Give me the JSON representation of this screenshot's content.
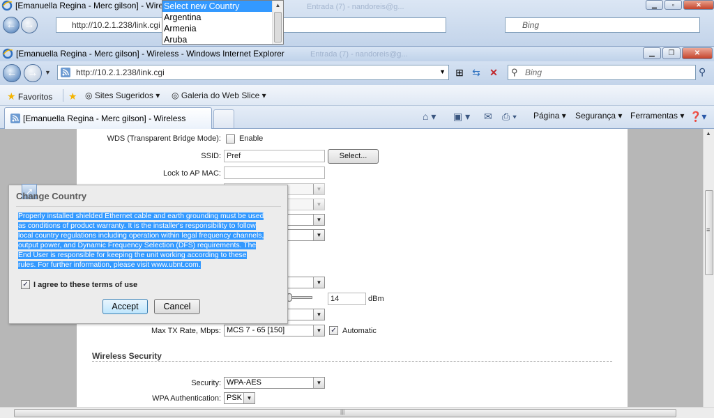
{
  "ghost_window": {
    "title": "[Emanuella Regina - Merc gilson] - Wire",
    "ghost_tab": "Entrada (7) - nandoreis@g...",
    "url": "http://10.2.1.238/link.cgi",
    "search_placeholder": "Bing",
    "fav_text": "Favoritos  Sites Sugeridos"
  },
  "country_dropdown": {
    "options": [
      "Select new Country",
      "Argentina",
      "Armenia",
      "Aruba"
    ],
    "selected_index": 0
  },
  "window": {
    "title": "[Emanuella Regina - Merc gilson] - Wireless - Windows Internet Explorer",
    "ghost_tab": "Entrada (7) - nandoreis@g..."
  },
  "navbar": {
    "url": "http://10.2.1.238/link.cgi",
    "search_placeholder": "Bing"
  },
  "favorites_bar": {
    "favorites": "Favoritos",
    "suggested_sites": "Sites Sugeridos",
    "web_slice_gallery": "Galeria do Web Slice"
  },
  "tabbar": {
    "active_tab": "[Emanuella Regina - Merc gilson] - Wireless",
    "commands": {
      "page": "Página",
      "security": "Segurança",
      "tools": "Ferramentas"
    }
  },
  "form": {
    "wds_label": "WDS (Transparent Bridge Mode):",
    "wds_enable": "Enable",
    "ssid_label": "SSID:",
    "ssid_value": "Pref",
    "select_button": "Select...",
    "lock_ap_label": "Lock to AP MAC:",
    "tx_power_value": "14",
    "tx_power_unit": "dBm",
    "max_tx_rate_label": "Max TX Rate, Mbps:",
    "max_tx_rate_value": "MCS 7 - 65 [150]",
    "automatic_label": "Automatic",
    "wireless_security_heading": "Wireless Security",
    "security_label": "Security:",
    "security_value": "WPA-AES",
    "wpa_auth_label": "WPA Authentication:",
    "wpa_auth_value": "PSK"
  },
  "dialog": {
    "title": "Change Country",
    "terms_lines": [
      "Properly installed shielded Ethernet cable and earth grounding must be used",
      "as conditions of product warranty. It is the installer's responsibility to follow",
      "local country regulations including operation within legal frequency channels,",
      "output power, and Dynamic Frequency Selection (DFS) requirements. The",
      "End User is responsible for keeping the unit working according to these",
      "rules. For further information, please visit www.ubnt.com."
    ],
    "agree_label": "I agree to these terms of use",
    "agree_checked": true,
    "accept_button": "Accept",
    "cancel_button": "Cancel"
  },
  "colors": {
    "selection": "#3399ff",
    "window_frame": "#c7d6ea"
  }
}
